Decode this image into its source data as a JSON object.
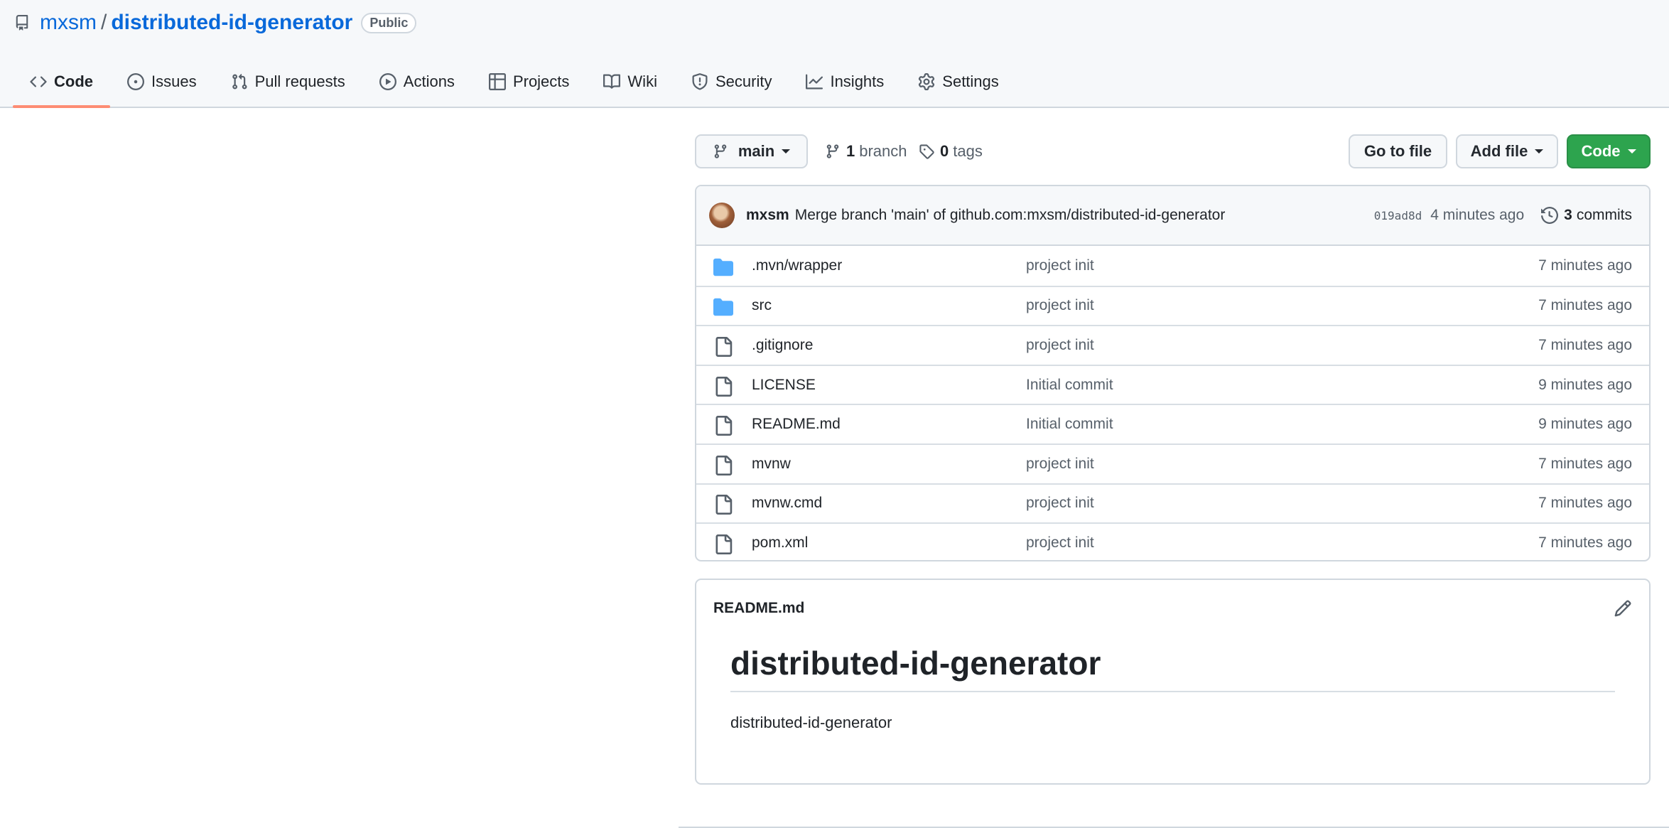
{
  "repo": {
    "owner": "mxsm",
    "separator": "/",
    "name": "distributed-id-generator",
    "visibility": "Public"
  },
  "tabs": [
    {
      "label": "Code",
      "icon": "code-icon",
      "active": true
    },
    {
      "label": "Issues",
      "icon": "issue-icon"
    },
    {
      "label": "Pull requests",
      "icon": "pull-request-icon"
    },
    {
      "label": "Actions",
      "icon": "play-icon"
    },
    {
      "label": "Projects",
      "icon": "table-icon"
    },
    {
      "label": "Wiki",
      "icon": "book-icon"
    },
    {
      "label": "Security",
      "icon": "shield-icon"
    },
    {
      "label": "Insights",
      "icon": "graph-icon"
    },
    {
      "label": "Settings",
      "icon": "gear-icon"
    }
  ],
  "toolbar": {
    "branch": "main",
    "branch_count": "1",
    "branch_label": "branch",
    "tag_count": "0",
    "tag_label": "tags",
    "goto_label": "Go to file",
    "add_file_label": "Add file",
    "code_label": "Code"
  },
  "latest_commit": {
    "author": "mxsm",
    "message": "Merge branch 'main' of github.com:mxsm/distributed-id-generator",
    "sha": "019ad8d",
    "time": "4 minutes ago",
    "commit_count": "3",
    "commits_label": "commits"
  },
  "files": [
    {
      "type": "folder",
      "name": ".mvn/wrapper",
      "message": "project init",
      "date": "7 minutes ago"
    },
    {
      "type": "folder",
      "name": "src",
      "message": "project init",
      "date": "7 minutes ago"
    },
    {
      "type": "file",
      "name": ".gitignore",
      "message": "project init",
      "date": "7 minutes ago"
    },
    {
      "type": "file",
      "name": "LICENSE",
      "message": "Initial commit",
      "date": "9 minutes ago"
    },
    {
      "type": "file",
      "name": "README.md",
      "message": "Initial commit",
      "date": "9 minutes ago"
    },
    {
      "type": "file",
      "name": "mvnw",
      "message": "project init",
      "date": "7 minutes ago"
    },
    {
      "type": "file",
      "name": "mvnw.cmd",
      "message": "project init",
      "date": "7 minutes ago"
    },
    {
      "type": "file",
      "name": "pom.xml",
      "message": "project init",
      "date": "7 minutes ago"
    }
  ],
  "readme": {
    "filename": "README.md",
    "heading": "distributed-id-generator",
    "body": "distributed-id-generator"
  },
  "colors": {
    "link": "#0969da",
    "active_tab_underline": "#fd8c73",
    "code_button": "#2da44e",
    "folder_icon": "#54aeff"
  }
}
